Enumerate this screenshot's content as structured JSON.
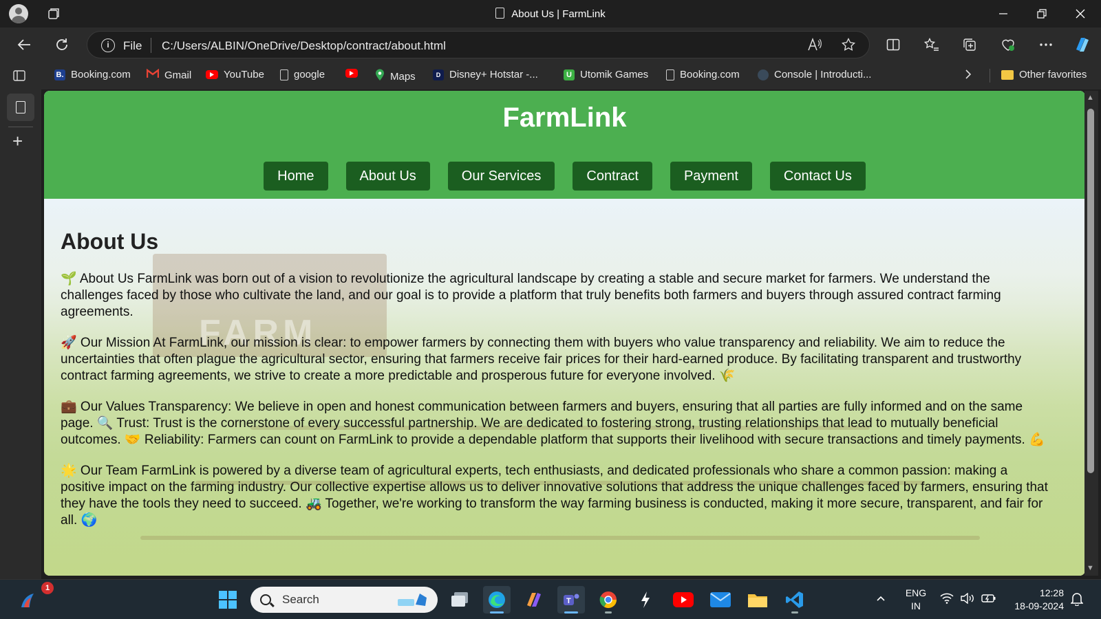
{
  "window": {
    "title": "About Us | FarmLink"
  },
  "address_bar": {
    "scheme_label": "File",
    "url": "C:/Users/ALBIN/OneDrive/Desktop/contract/about.html"
  },
  "favorites": [
    {
      "label": "Booking.com",
      "icon": "booking-icon",
      "color": "#1e3f8f"
    },
    {
      "label": "Gmail",
      "icon": "gmail-icon",
      "color": "#ea4335"
    },
    {
      "label": "YouTube",
      "icon": "youtube-icon",
      "color": "#ff0000"
    },
    {
      "label": "google",
      "icon": "page-icon",
      "color": "#cccccc"
    },
    {
      "label": "",
      "icon": "youtube-icon",
      "color": "#ff0000"
    },
    {
      "label": "Maps",
      "icon": "maps-icon",
      "color": "#34a853"
    },
    {
      "label": "Disney+ Hotstar -...",
      "icon": "hotstar-icon",
      "color": "#0f1c4d"
    },
    {
      "label": "Utomik Games",
      "icon": "utomik-icon",
      "color": "#3cb043"
    },
    {
      "label": "Booking.com",
      "icon": "page-icon",
      "color": "#cccccc"
    },
    {
      "label": "Console | Introducti...",
      "icon": "console-icon",
      "color": "#3a4a5a"
    }
  ],
  "other_favorites": "Other favorites",
  "site": {
    "brand": "FarmLink",
    "nav": [
      "Home",
      "About Us",
      "Our Services",
      "Contract",
      "Payment",
      "Contact Us"
    ],
    "heading": "About Us",
    "paragraphs": [
      "🌱 About Us FarmLink was born out of a vision to revolutionize the agricultural landscape by creating a stable and secure market for farmers. We understand the challenges faced by those who cultivate the land, and our goal is to provide a platform that truly benefits both farmers and buyers through assured contract farming agreements.",
      "🚀 Our Mission At FarmLink, our mission is clear: to empower farmers by connecting them with buyers who value transparency and reliability. We aim to reduce the uncertainties that often plague the agricultural sector, ensuring that farmers receive fair prices for their hard-earned produce. By facilitating transparent and trustworthy contract farming agreements, we strive to create a more predictable and prosperous future for everyone involved. 🌾",
      "💼 Our Values Transparency: We believe in open and honest communication between farmers and buyers, ensuring that all parties are fully informed and on the same page. 🔍 Trust: Trust is the cornerstone of every successful partnership. We are dedicated to fostering strong, trusting relationships that lead to mutually beneficial outcomes. 🤝 Reliability: Farmers can count on FarmLink to provide a dependable platform that supports their livelihood with secure transactions and timely payments. 💪",
      "🌟 Our Team FarmLink is powered by a diverse team of agricultural experts, tech enthusiasts, and dedicated professionals who share a common passion: making a positive impact on the farming industry. Our collective expertise allows us to deliver innovative solutions that address the unique challenges faced by farmers, ensuring that they have the tools they need to succeed. 🚜 Together, we're working to transform the way farming business is conducted, making it more secure, transparent, and fair for all. 🌍"
    ],
    "background_sign_text": "FARM",
    "colors": {
      "header": "#4caf50",
      "nav_button": "#1b5e20"
    }
  },
  "taskbar": {
    "search_placeholder": "Search",
    "notification_count": "1",
    "language": "ENG",
    "region": "IN",
    "time": "12:28",
    "date": "18-09-2024"
  }
}
